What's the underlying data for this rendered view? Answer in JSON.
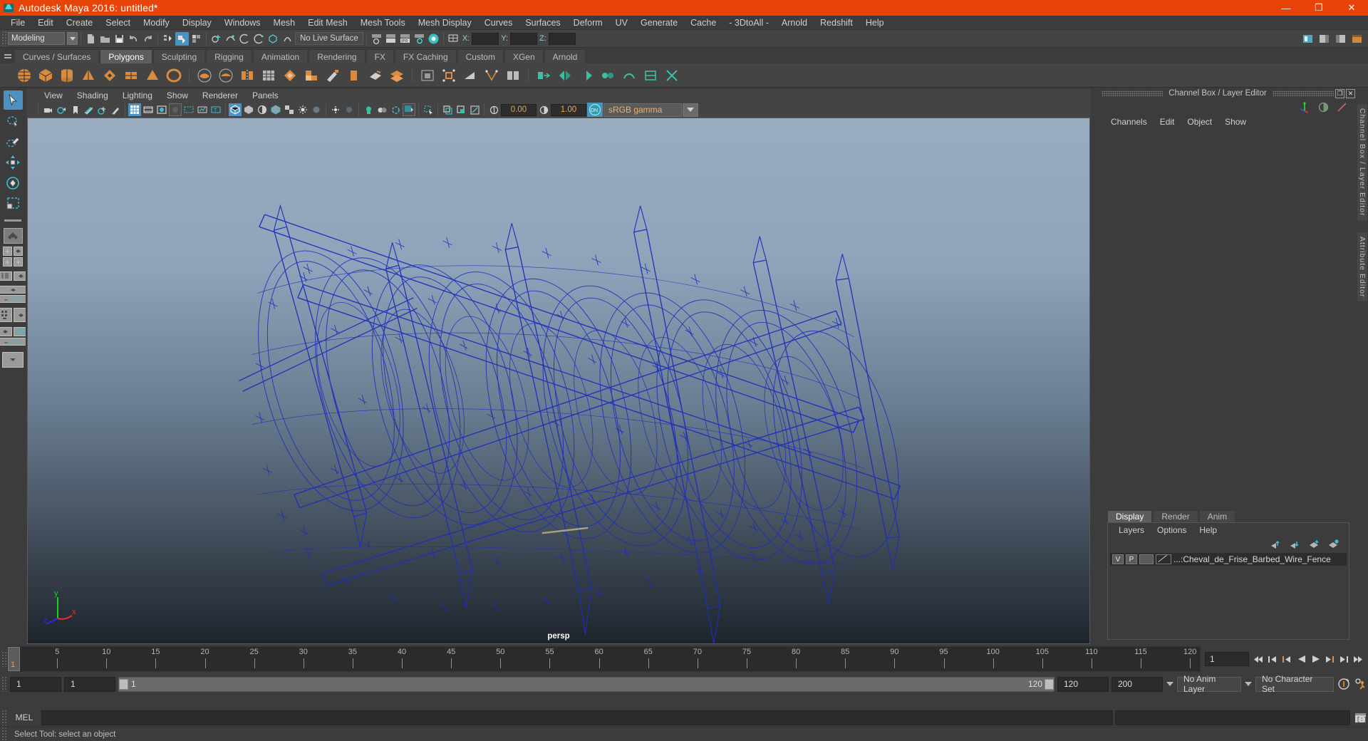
{
  "window": {
    "title": "Autodesk Maya 2016: untitled*",
    "icon": "maya-logo-icon",
    "minimize_label": "—",
    "maximize_label": "❐",
    "close_label": "✕",
    "accent_color": "#e8440a"
  },
  "menubar": {
    "items": [
      "File",
      "Edit",
      "Create",
      "Select",
      "Modify",
      "Display",
      "Windows",
      "Mesh",
      "Edit Mesh",
      "Mesh Tools",
      "Mesh Display",
      "Curves",
      "Surfaces",
      "Deform",
      "UV",
      "Generate",
      "Cache",
      "- 3DtoAll -",
      "Arnold",
      "Redshift",
      "Help"
    ]
  },
  "statusline": {
    "mode_selected": "Modeling",
    "live_surface": "No Live Surface",
    "coord_labels": [
      "X:",
      "Y:",
      "Z:"
    ],
    "coord_values": [
      "",
      "",
      ""
    ]
  },
  "shelf": {
    "tabs": [
      "Curves / Surfaces",
      "Polygons",
      "Sculpting",
      "Rigging",
      "Animation",
      "Rendering",
      "FX",
      "FX Caching",
      "Custom",
      "XGen",
      "Arnold"
    ],
    "selected_tab": "Polygons"
  },
  "viewport": {
    "panel_menu": [
      "View",
      "Shading",
      "Lighting",
      "Show",
      "Renderer",
      "Panels"
    ],
    "exposure_value": "0.00",
    "gamma_value": "1.00",
    "color_management_toggle": "ON",
    "color_profile": "sRGB gamma",
    "camera_label": "persp",
    "axis_labels": [
      "y",
      "z",
      "x"
    ],
    "model_description": "Cheval de Frise barbed wire fence wireframe"
  },
  "channel_box": {
    "panel_title": "Channel Box / Layer Editor",
    "menu": [
      "Channels",
      "Edit",
      "Object",
      "Show"
    ],
    "undock_label": "❐",
    "close_label": "✕"
  },
  "layer_editor": {
    "tabs": [
      "Display",
      "Render",
      "Anim"
    ],
    "selected_tab": "Display",
    "menu": [
      "Layers",
      "Options",
      "Help"
    ],
    "layers": [
      {
        "visibility": "V",
        "playback": "P",
        "color_swatch": "",
        "name": "...:Cheval_de_Frise_Barbed_Wire_Fence"
      }
    ]
  },
  "right_vertical_tabs": [
    "Channel Box / Layer Editor",
    "Attribute Editor"
  ],
  "timeline": {
    "tick_labels": [
      "5",
      "10",
      "15",
      "20",
      "25",
      "30",
      "35",
      "40",
      "45",
      "50",
      "55",
      "60",
      "65",
      "70",
      "75",
      "80",
      "85",
      "90",
      "95",
      "100",
      "105",
      "110",
      "115",
      "120"
    ],
    "current_frame_marker": "1",
    "current_frame_field": "1",
    "playback_buttons": [
      "go-to-start",
      "step-back-key",
      "step-back-frame",
      "play-backwards",
      "play-forwards",
      "step-forward-frame",
      "step-forward-key",
      "go-to-end"
    ]
  },
  "range_slider": {
    "anim_start": "1",
    "range_start": "1",
    "range_bar_start": "1",
    "range_bar_end": "120",
    "range_end": "120",
    "anim_end": "200",
    "anim_layer": "No Anim Layer",
    "character_set": "No Character Set",
    "auto_key_icon": "auto-keyframe-icon",
    "prefs_icon": "animation-preferences-icon"
  },
  "command_line": {
    "language_label": "MEL",
    "input_value": "",
    "input_placeholder": "",
    "script_editor_icon": "script-editor-icon"
  },
  "help_line": {
    "message": "Select Tool: select an object"
  },
  "toolbox": {
    "tools": [
      "select-tool",
      "lasso-select-tool",
      "paint-select-tool",
      "move-tool",
      "rotate-tool",
      "scale-tool"
    ],
    "selected_tool": "select-tool",
    "layout_presets": [
      "single-perspective-view",
      "four-view",
      "outliner-persp",
      "hypergraph-persp",
      "persp-graph-editor",
      "outliner-persp-graph",
      "persp-hypershade",
      "more-layouts"
    ]
  }
}
